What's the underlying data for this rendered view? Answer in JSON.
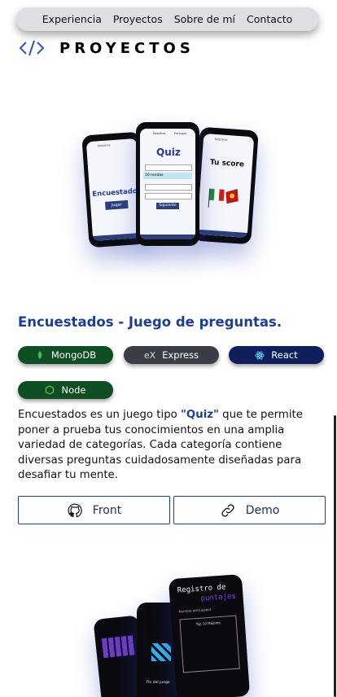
{
  "nav": {
    "items": [
      "Experiencia",
      "Proyectos",
      "Sobre de mí",
      "Contacto"
    ]
  },
  "section": {
    "title": "PROYECTOS",
    "icon": "code-icon"
  },
  "project": {
    "title": "Encuestados - Juego de preguntas.",
    "description_before": "Encuestados es un juego tipo ",
    "description_highlight": "\"Quiz\"",
    "description_after": " que te permite poner a prueba tus conocimientos en una amplia variedad de categorías. Cada categoría contiene diversas preguntas cuidadosamente diseñadas para desafiar tu mente.",
    "technologies": [
      {
        "label": "MongoDB",
        "icon": "mongodb-leaf-icon",
        "color": "#0f4d23"
      },
      {
        "label": "Express",
        "icon": "express-icon",
        "color": "#3a3d46"
      },
      {
        "label": "React",
        "icon": "react-icon",
        "color": "#0e1f5b"
      },
      {
        "label": "Node",
        "icon": "nodejs-icon",
        "color": "#0f4d23"
      }
    ],
    "buttons": {
      "front_label": "Front",
      "demo_label": "Demo"
    }
  },
  "mockup_texts": {
    "left_word": "Encuestados",
    "left_button": "Jugar",
    "center_title": "Quiz",
    "center_input": "10 rondas",
    "center_button": "Siguiente",
    "right_title": "Tu score",
    "phone_nav_a": "Nosotros",
    "phone_nav_b": "Portugas"
  },
  "bottom_mockup": {
    "title": "Registro de",
    "subtitle": "puntajes",
    "label_a": "Nombre del Jugador",
    "label_b": "Top 10 Mejores",
    "label_c": "Fin del juego"
  },
  "colors": {
    "accent": "#1b3e99",
    "mongo_green": "#0f4d23",
    "express_gray": "#3a3d46",
    "react_navy": "#0e1f5b"
  }
}
